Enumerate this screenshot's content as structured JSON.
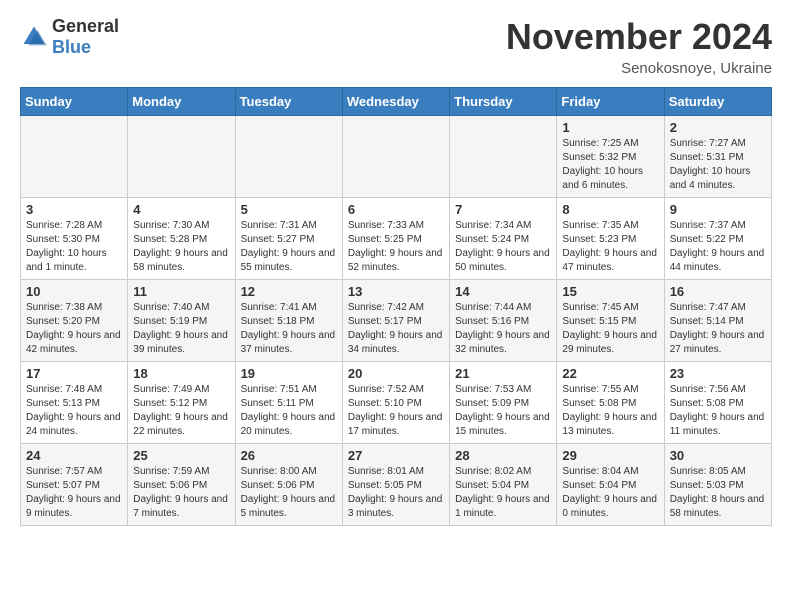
{
  "logo": {
    "general": "General",
    "blue": "Blue"
  },
  "header": {
    "month": "November 2024",
    "location": "Senokosnoye, Ukraine"
  },
  "days_of_week": [
    "Sunday",
    "Monday",
    "Tuesday",
    "Wednesday",
    "Thursday",
    "Friday",
    "Saturday"
  ],
  "weeks": [
    [
      {
        "day": "",
        "info": ""
      },
      {
        "day": "",
        "info": ""
      },
      {
        "day": "",
        "info": ""
      },
      {
        "day": "",
        "info": ""
      },
      {
        "day": "",
        "info": ""
      },
      {
        "day": "1",
        "info": "Sunrise: 7:25 AM\nSunset: 5:32 PM\nDaylight: 10 hours and 6 minutes."
      },
      {
        "day": "2",
        "info": "Sunrise: 7:27 AM\nSunset: 5:31 PM\nDaylight: 10 hours and 4 minutes."
      }
    ],
    [
      {
        "day": "3",
        "info": "Sunrise: 7:28 AM\nSunset: 5:30 PM\nDaylight: 10 hours and 1 minute."
      },
      {
        "day": "4",
        "info": "Sunrise: 7:30 AM\nSunset: 5:28 PM\nDaylight: 9 hours and 58 minutes."
      },
      {
        "day": "5",
        "info": "Sunrise: 7:31 AM\nSunset: 5:27 PM\nDaylight: 9 hours and 55 minutes."
      },
      {
        "day": "6",
        "info": "Sunrise: 7:33 AM\nSunset: 5:25 PM\nDaylight: 9 hours and 52 minutes."
      },
      {
        "day": "7",
        "info": "Sunrise: 7:34 AM\nSunset: 5:24 PM\nDaylight: 9 hours and 50 minutes."
      },
      {
        "day": "8",
        "info": "Sunrise: 7:35 AM\nSunset: 5:23 PM\nDaylight: 9 hours and 47 minutes."
      },
      {
        "day": "9",
        "info": "Sunrise: 7:37 AM\nSunset: 5:22 PM\nDaylight: 9 hours and 44 minutes."
      }
    ],
    [
      {
        "day": "10",
        "info": "Sunrise: 7:38 AM\nSunset: 5:20 PM\nDaylight: 9 hours and 42 minutes."
      },
      {
        "day": "11",
        "info": "Sunrise: 7:40 AM\nSunset: 5:19 PM\nDaylight: 9 hours and 39 minutes."
      },
      {
        "day": "12",
        "info": "Sunrise: 7:41 AM\nSunset: 5:18 PM\nDaylight: 9 hours and 37 minutes."
      },
      {
        "day": "13",
        "info": "Sunrise: 7:42 AM\nSunset: 5:17 PM\nDaylight: 9 hours and 34 minutes."
      },
      {
        "day": "14",
        "info": "Sunrise: 7:44 AM\nSunset: 5:16 PM\nDaylight: 9 hours and 32 minutes."
      },
      {
        "day": "15",
        "info": "Sunrise: 7:45 AM\nSunset: 5:15 PM\nDaylight: 9 hours and 29 minutes."
      },
      {
        "day": "16",
        "info": "Sunrise: 7:47 AM\nSunset: 5:14 PM\nDaylight: 9 hours and 27 minutes."
      }
    ],
    [
      {
        "day": "17",
        "info": "Sunrise: 7:48 AM\nSunset: 5:13 PM\nDaylight: 9 hours and 24 minutes."
      },
      {
        "day": "18",
        "info": "Sunrise: 7:49 AM\nSunset: 5:12 PM\nDaylight: 9 hours and 22 minutes."
      },
      {
        "day": "19",
        "info": "Sunrise: 7:51 AM\nSunset: 5:11 PM\nDaylight: 9 hours and 20 minutes."
      },
      {
        "day": "20",
        "info": "Sunrise: 7:52 AM\nSunset: 5:10 PM\nDaylight: 9 hours and 17 minutes."
      },
      {
        "day": "21",
        "info": "Sunrise: 7:53 AM\nSunset: 5:09 PM\nDaylight: 9 hours and 15 minutes."
      },
      {
        "day": "22",
        "info": "Sunrise: 7:55 AM\nSunset: 5:08 PM\nDaylight: 9 hours and 13 minutes."
      },
      {
        "day": "23",
        "info": "Sunrise: 7:56 AM\nSunset: 5:08 PM\nDaylight: 9 hours and 11 minutes."
      }
    ],
    [
      {
        "day": "24",
        "info": "Sunrise: 7:57 AM\nSunset: 5:07 PM\nDaylight: 9 hours and 9 minutes."
      },
      {
        "day": "25",
        "info": "Sunrise: 7:59 AM\nSunset: 5:06 PM\nDaylight: 9 hours and 7 minutes."
      },
      {
        "day": "26",
        "info": "Sunrise: 8:00 AM\nSunset: 5:06 PM\nDaylight: 9 hours and 5 minutes."
      },
      {
        "day": "27",
        "info": "Sunrise: 8:01 AM\nSunset: 5:05 PM\nDaylight: 9 hours and 3 minutes."
      },
      {
        "day": "28",
        "info": "Sunrise: 8:02 AM\nSunset: 5:04 PM\nDaylight: 9 hours and 1 minute."
      },
      {
        "day": "29",
        "info": "Sunrise: 8:04 AM\nSunset: 5:04 PM\nDaylight: 9 hours and 0 minutes."
      },
      {
        "day": "30",
        "info": "Sunrise: 8:05 AM\nSunset: 5:03 PM\nDaylight: 8 hours and 58 minutes."
      }
    ]
  ]
}
